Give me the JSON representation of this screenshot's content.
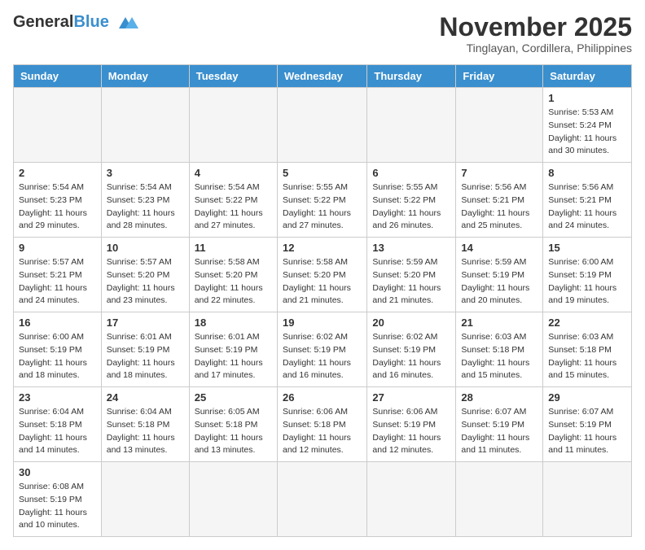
{
  "header": {
    "logo_general": "General",
    "logo_blue": "Blue",
    "month_title": "November 2025",
    "location": "Tinglayan, Cordillera, Philippines"
  },
  "weekdays": [
    "Sunday",
    "Monday",
    "Tuesday",
    "Wednesday",
    "Thursday",
    "Friday",
    "Saturday"
  ],
  "weeks": [
    [
      {
        "day": "",
        "info": ""
      },
      {
        "day": "",
        "info": ""
      },
      {
        "day": "",
        "info": ""
      },
      {
        "day": "",
        "info": ""
      },
      {
        "day": "",
        "info": ""
      },
      {
        "day": "",
        "info": ""
      },
      {
        "day": "1",
        "info": "Sunrise: 5:53 AM\nSunset: 5:24 PM\nDaylight: 11 hours\nand 30 minutes."
      }
    ],
    [
      {
        "day": "2",
        "info": "Sunrise: 5:54 AM\nSunset: 5:23 PM\nDaylight: 11 hours\nand 29 minutes."
      },
      {
        "day": "3",
        "info": "Sunrise: 5:54 AM\nSunset: 5:23 PM\nDaylight: 11 hours\nand 28 minutes."
      },
      {
        "day": "4",
        "info": "Sunrise: 5:54 AM\nSunset: 5:22 PM\nDaylight: 11 hours\nand 27 minutes."
      },
      {
        "day": "5",
        "info": "Sunrise: 5:55 AM\nSunset: 5:22 PM\nDaylight: 11 hours\nand 27 minutes."
      },
      {
        "day": "6",
        "info": "Sunrise: 5:55 AM\nSunset: 5:22 PM\nDaylight: 11 hours\nand 26 minutes."
      },
      {
        "day": "7",
        "info": "Sunrise: 5:56 AM\nSunset: 5:21 PM\nDaylight: 11 hours\nand 25 minutes."
      },
      {
        "day": "8",
        "info": "Sunrise: 5:56 AM\nSunset: 5:21 PM\nDaylight: 11 hours\nand 24 minutes."
      }
    ],
    [
      {
        "day": "9",
        "info": "Sunrise: 5:57 AM\nSunset: 5:21 PM\nDaylight: 11 hours\nand 24 minutes."
      },
      {
        "day": "10",
        "info": "Sunrise: 5:57 AM\nSunset: 5:20 PM\nDaylight: 11 hours\nand 23 minutes."
      },
      {
        "day": "11",
        "info": "Sunrise: 5:58 AM\nSunset: 5:20 PM\nDaylight: 11 hours\nand 22 minutes."
      },
      {
        "day": "12",
        "info": "Sunrise: 5:58 AM\nSunset: 5:20 PM\nDaylight: 11 hours\nand 21 minutes."
      },
      {
        "day": "13",
        "info": "Sunrise: 5:59 AM\nSunset: 5:20 PM\nDaylight: 11 hours\nand 21 minutes."
      },
      {
        "day": "14",
        "info": "Sunrise: 5:59 AM\nSunset: 5:19 PM\nDaylight: 11 hours\nand 20 minutes."
      },
      {
        "day": "15",
        "info": "Sunrise: 6:00 AM\nSunset: 5:19 PM\nDaylight: 11 hours\nand 19 minutes."
      }
    ],
    [
      {
        "day": "16",
        "info": "Sunrise: 6:00 AM\nSunset: 5:19 PM\nDaylight: 11 hours\nand 18 minutes."
      },
      {
        "day": "17",
        "info": "Sunrise: 6:01 AM\nSunset: 5:19 PM\nDaylight: 11 hours\nand 18 minutes."
      },
      {
        "day": "18",
        "info": "Sunrise: 6:01 AM\nSunset: 5:19 PM\nDaylight: 11 hours\nand 17 minutes."
      },
      {
        "day": "19",
        "info": "Sunrise: 6:02 AM\nSunset: 5:19 PM\nDaylight: 11 hours\nand 16 minutes."
      },
      {
        "day": "20",
        "info": "Sunrise: 6:02 AM\nSunset: 5:19 PM\nDaylight: 11 hours\nand 16 minutes."
      },
      {
        "day": "21",
        "info": "Sunrise: 6:03 AM\nSunset: 5:18 PM\nDaylight: 11 hours\nand 15 minutes."
      },
      {
        "day": "22",
        "info": "Sunrise: 6:03 AM\nSunset: 5:18 PM\nDaylight: 11 hours\nand 15 minutes."
      }
    ],
    [
      {
        "day": "23",
        "info": "Sunrise: 6:04 AM\nSunset: 5:18 PM\nDaylight: 11 hours\nand 14 minutes."
      },
      {
        "day": "24",
        "info": "Sunrise: 6:04 AM\nSunset: 5:18 PM\nDaylight: 11 hours\nand 13 minutes."
      },
      {
        "day": "25",
        "info": "Sunrise: 6:05 AM\nSunset: 5:18 PM\nDaylight: 11 hours\nand 13 minutes."
      },
      {
        "day": "26",
        "info": "Sunrise: 6:06 AM\nSunset: 5:18 PM\nDaylight: 11 hours\nand 12 minutes."
      },
      {
        "day": "27",
        "info": "Sunrise: 6:06 AM\nSunset: 5:19 PM\nDaylight: 11 hours\nand 12 minutes."
      },
      {
        "day": "28",
        "info": "Sunrise: 6:07 AM\nSunset: 5:19 PM\nDaylight: 11 hours\nand 11 minutes."
      },
      {
        "day": "29",
        "info": "Sunrise: 6:07 AM\nSunset: 5:19 PM\nDaylight: 11 hours\nand 11 minutes."
      }
    ],
    [
      {
        "day": "30",
        "info": "Sunrise: 6:08 AM\nSunset: 5:19 PM\nDaylight: 11 hours\nand 10 minutes."
      },
      {
        "day": "",
        "info": ""
      },
      {
        "day": "",
        "info": ""
      },
      {
        "day": "",
        "info": ""
      },
      {
        "day": "",
        "info": ""
      },
      {
        "day": "",
        "info": ""
      },
      {
        "day": "",
        "info": ""
      }
    ]
  ]
}
